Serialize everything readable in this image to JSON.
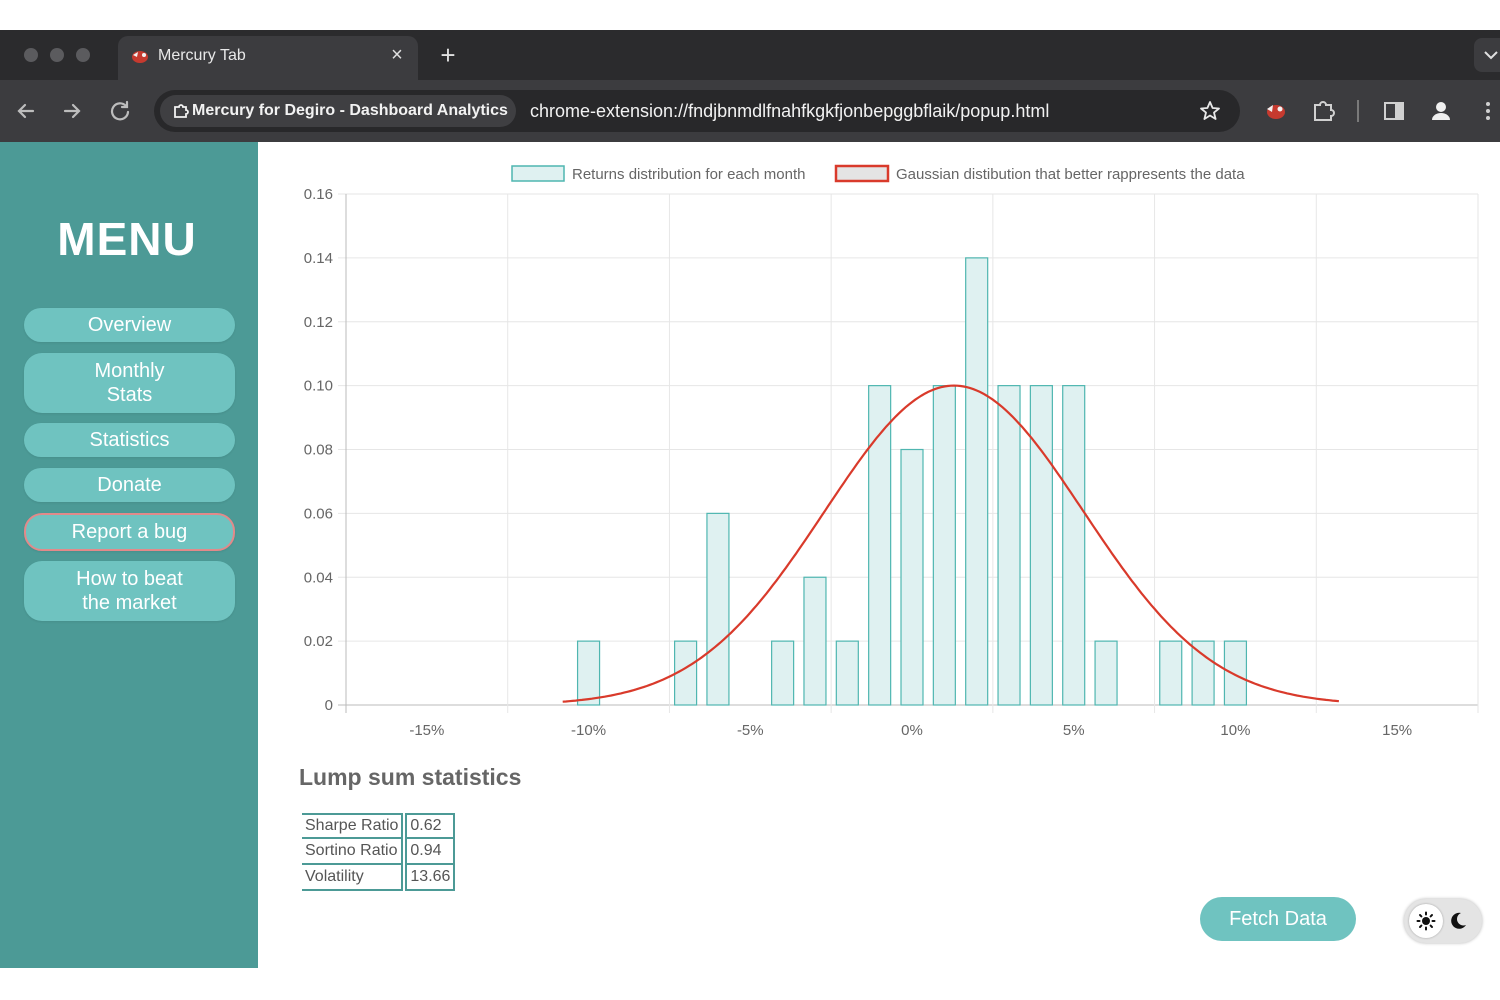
{
  "browser": {
    "tab_title": "Mercury Tab",
    "tab_close": "×",
    "new_tab": "+",
    "site_chip": "Mercury for Degiro - Dashboard Analytics",
    "url": "chrome-extension://fndjbnmdlfnahfkgkfjonbepggbflaik/popup.html",
    "icons": [
      "back-arrow-icon",
      "forward-arrow-icon",
      "reload-icon",
      "extension-puzzle-icon",
      "star-icon",
      "side-panel-icon",
      "profile-icon",
      "more-menu-icon"
    ]
  },
  "sidebar": {
    "title": "MENU",
    "items": [
      {
        "label": "Overview"
      },
      {
        "label": "Monthly Stats"
      },
      {
        "label": "Statistics"
      },
      {
        "label": "Donate"
      },
      {
        "label": "Report a bug"
      },
      {
        "label": "How to beat the market"
      }
    ],
    "colors": {
      "background": "#4c9a96",
      "button": "#6fc3c0",
      "bug_border": "#e28a8a"
    }
  },
  "chart_data": {
    "type": "bar",
    "legend": [
      "Returns distribution for each month",
      "Gaussian distibution that better rappresents the data"
    ],
    "legend_position": "top",
    "grid": true,
    "x_ticks": [
      "-15%",
      "-10%",
      "-5%",
      "0%",
      "5%",
      "10%",
      "15%"
    ],
    "xlim": [
      -17.5,
      17.5
    ],
    "y_ticks": [
      "0",
      "0.02",
      "0.04",
      "0.06",
      "0.08",
      "0.10",
      "0.12",
      "0.14",
      "0.16"
    ],
    "ylim": [
      0,
      0.16
    ],
    "bin_width": 1,
    "series": [
      {
        "type": "bar",
        "bins_center": [
          -10,
          -7,
          -6,
          -4,
          -3,
          -2,
          -1,
          0,
          1,
          2,
          3,
          4,
          5,
          6,
          8,
          9,
          10
        ],
        "values": [
          0.02,
          0.02,
          0.06,
          0.02,
          0.04,
          0.02,
          0.1,
          0.08,
          0.1,
          0.14,
          0.1,
          0.1,
          0.1,
          0.02,
          0.02,
          0.02,
          0.02
        ],
        "color": "#4fb6b0",
        "fill": "#dff1f1"
      },
      {
        "type": "line",
        "distribution": "gaussian",
        "mean": 1.3,
        "std": 4,
        "x_range": [
          -10.8,
          13.2
        ],
        "color": "#d93a2b"
      }
    ]
  },
  "stats": {
    "title": "Lump sum statistics",
    "rows": [
      {
        "label": "Sharpe Ratio",
        "value": "0.62"
      },
      {
        "label": "Sortino Ratio",
        "value": "0.94"
      },
      {
        "label": "Volatility",
        "value": "13.66"
      }
    ]
  },
  "controls": {
    "fetch_label": "Fetch Data",
    "theme_icons": [
      "sun-icon",
      "moon-icon"
    ]
  }
}
